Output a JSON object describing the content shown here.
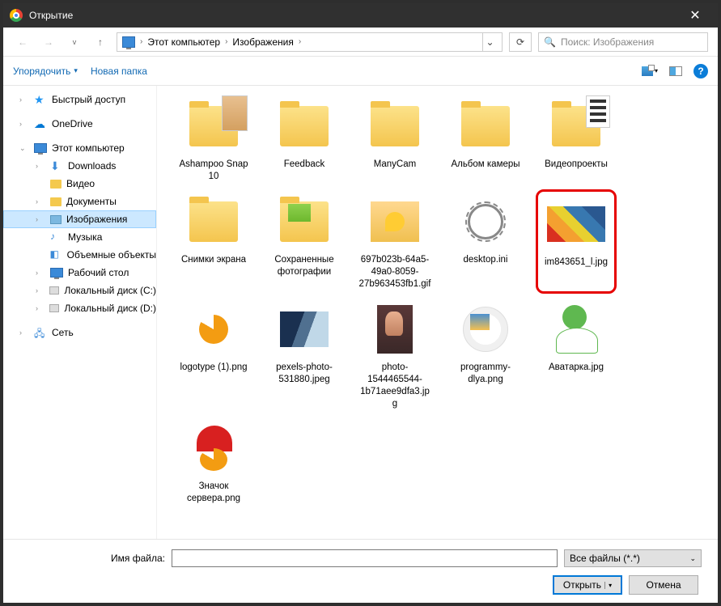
{
  "window": {
    "title": "Открытие"
  },
  "breadcrumb": {
    "root": "Этот компьютер",
    "current": "Изображения"
  },
  "search": {
    "placeholder": "Поиск: Изображения"
  },
  "toolbar": {
    "organize": "Упорядочить",
    "newfolder": "Новая папка"
  },
  "sidebar": {
    "quick": "Быстрый доступ",
    "onedrive": "OneDrive",
    "thispc": "Этот компьютер",
    "downloads": "Downloads",
    "video": "Видео",
    "documents": "Документы",
    "pictures": "Изображения",
    "music": "Музыка",
    "objects3d": "Объемные объекты",
    "desktop": "Рабочий стол",
    "diskC": "Локальный диск (C:)",
    "diskD": "Локальный диск (D:)",
    "network": "Сеть"
  },
  "files": {
    "f0": "Ashampoo Snap 10",
    "f1": "Feedback",
    "f2": "ManyCam",
    "f3": "Альбом камеры",
    "f4": "Видеопроекты",
    "f5": "Снимки экрана",
    "f6": "Сохраненные фотографии",
    "f7": "697b023b-64a5-49a0-8059-27b963453fb1.gif",
    "f8": "desktop.ini",
    "f9": "im843651_l.jpg",
    "f10": "logotype (1).png",
    "f11": "pexels-photo-531880.jpeg",
    "f12": "photo-1544465544-1b71aee9dfa3.jpg",
    "f13": "programmy-dlya.png",
    "f14": "Аватарка.jpg",
    "f15": "Значок сервера.png"
  },
  "bottom": {
    "filename_label": "Имя файла:",
    "filename_value": "",
    "filetype": "Все файлы (*.*)",
    "open": "Открыть",
    "cancel": "Отмена"
  }
}
